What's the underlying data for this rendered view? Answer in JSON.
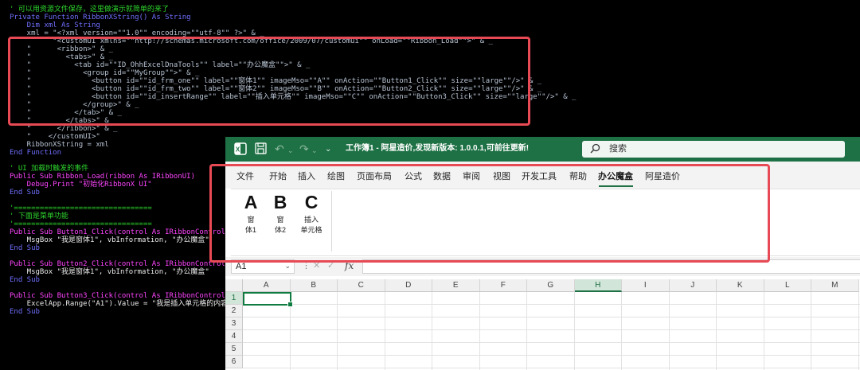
{
  "code": {
    "lines": [
      {
        "text": "' 可以用资源文件保存，这里做演示就简单的来了",
        "color": "#2ed52e"
      },
      {
        "text": "Private Function RibbonXString() As String",
        "color": "#6f6fff"
      },
      {
        "text": "    Dim xml As String",
        "color": "#6f6fff"
      },
      {
        "text": "    xml = \"<?xml version=\"\"1.0\"\" encoding=\"\"utf-8\"\" ?>\" & _",
        "color": "#b8c4d4"
      },
      {
        "text": "          \"<customUI xmlns=\"\"http://schemas.microsoft.com/office/2009/07/customui\"\" onLoad=\"\"Ribbon_Load\"\">\" & _",
        "color": "#b8c4d4"
      },
      {
        "text": "    \"      <ribbon>\" & _",
        "color": "#b8c4d4"
      },
      {
        "text": "    \"        <tabs>\" & _",
        "color": "#b8c4d4"
      },
      {
        "text": "    \"          <tab id=\"\"ID_OhhExcelDnaTools\"\" label=\"\"办公魔盒\"\">\" & _",
        "color": "#b8c4d4"
      },
      {
        "text": "    \"            <group id=\"\"MyGroup\"\">\" & _",
        "color": "#b8c4d4"
      },
      {
        "text": "    \"              <button id=\"\"id_frm_one\"\" label=\"\"窗体1\"\" imageMso=\"\"A\"\" onAction=\"\"Button1_Click\"\" size=\"\"large\"\"/>\" & _",
        "color": "#b8c4d4"
      },
      {
        "text": "    \"              <button id=\"\"id_frm_two\"\" label=\"\"窗体2\"\" imageMso=\"\"B\"\" onAction=\"\"Button2_Click\"\" size=\"\"large\"\"/>\" & _",
        "color": "#b8c4d4"
      },
      {
        "text": "    \"              <button id=\"\"id_insertRange\"\" label=\"\"插入单元格\"\" imageMso=\"\"C\"\" onAction=\"\"Button3_Click\"\" size=\"\"large\"\"/>\" & _",
        "color": "#b8c4d4"
      },
      {
        "text": "    \"            </group>\" & _",
        "color": "#b8c4d4"
      },
      {
        "text": "    \"          </tab>\" & _",
        "color": "#b8c4d4"
      },
      {
        "text": "    \"        </tabs>\" & _",
        "color": "#b8c4d4"
      },
      {
        "text": "    \"      </ribbon>\" & _",
        "color": "#b8c4d4"
      },
      {
        "text": "    \"    </customUI>\"",
        "color": "#b8c4d4"
      },
      {
        "text": "    RibbonXString = xml",
        "color": "#b8c4d4"
      },
      {
        "text": "End Function",
        "color": "#6f6fff"
      },
      {
        "text": "",
        "color": "#b8c4d4"
      },
      {
        "text": "' UI 加载时触发的事件",
        "color": "#2ed52e"
      },
      {
        "text": "Public Sub Ribbon_Load(ribbon As IRibbonUI)",
        "color": "#ff45ff"
      },
      {
        "text": "    Debug.Print \"初始化RibbonX UI\"",
        "color": "#ff45ff"
      },
      {
        "text": "End Sub",
        "color": "#6f6fff"
      },
      {
        "text": "",
        "color": "#b8c4d4"
      },
      {
        "text": "'================================",
        "color": "#2ed52e"
      },
      {
        "text": "' 下面是菜单功能",
        "color": "#2ed52e"
      },
      {
        "text": "'================================",
        "color": "#2ed52e"
      },
      {
        "text": "Public Sub Button1_Click(control As IRibbonControl)",
        "color": "#ff45ff"
      },
      {
        "text": "    MsgBox \"我是窗体1\", vbInformation, \"办公魔盒\"",
        "color": "#eaeaea"
      },
      {
        "text": "End Sub",
        "color": "#6f6fff"
      },
      {
        "text": "",
        "color": "#b8c4d4"
      },
      {
        "text": "Public Sub Button2_Click(control As IRibbonControl)",
        "color": "#ff45ff"
      },
      {
        "text": "    MsgBox \"我是窗体1\", vbInformation, \"办公魔盒\"",
        "color": "#eaeaea"
      },
      {
        "text": "End Sub",
        "color": "#6f6fff"
      },
      {
        "text": "",
        "color": "#b8c4d4"
      },
      {
        "text": "Public Sub Button3_Click(control As IRibbonControl)",
        "color": "#ff45ff"
      },
      {
        "text": "    ExcelApp.Range(\"A1\").Value = \"我是插入单元格的内容\"",
        "color": "#eaeaea"
      },
      {
        "text": "End Sub",
        "color": "#6f6fff"
      }
    ]
  },
  "excel": {
    "title": "工作簿1 - 阿星造价,发现新版本: 1.0.0.1,可前往更新!",
    "search_label": "搜索",
    "icons": {
      "logo": "excel-logo-icon",
      "save": "save-icon",
      "undo": "undo-icon",
      "redo": "redo-icon",
      "customize": "customize-quick-access-icon",
      "search": "search-icon"
    },
    "tabs": [
      "文件",
      "开始",
      "插入",
      "绘图",
      "页面布局",
      "公式",
      "数据",
      "审阅",
      "视图",
      "开发工具",
      "帮助",
      "办公魔盒",
      "阿星造价"
    ],
    "active_tab": "办公魔盒",
    "ribbon_buttons": [
      {
        "glyph": "A",
        "label_line1": "窗",
        "label_line2": "体1"
      },
      {
        "glyph": "B",
        "label_line1": "窗",
        "label_line2": "体2"
      },
      {
        "glyph": "C",
        "label_line1": "插入",
        "label_line2": "单元格"
      }
    ],
    "name_box": "A1",
    "fx_label": "fx",
    "columns": [
      "A",
      "B",
      "C",
      "D",
      "E",
      "F",
      "G",
      "H",
      "I",
      "J",
      "K",
      "L",
      "M"
    ],
    "selected_column": "H",
    "rows": [
      "1",
      "2",
      "3",
      "4",
      "5",
      "6"
    ],
    "active_cell": "A1",
    "accent_color": "#1e7145",
    "highlight_color": "#e84a55"
  }
}
